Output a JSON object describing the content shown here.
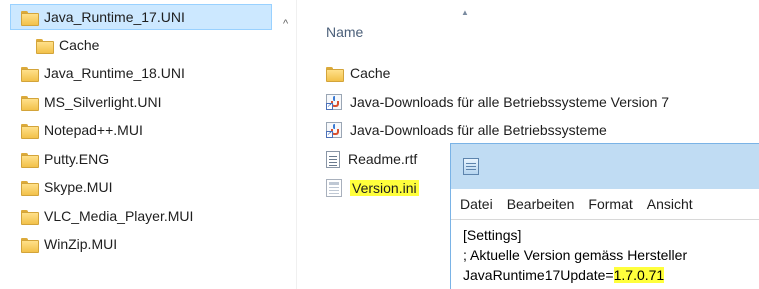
{
  "nav_tree": {
    "items": [
      {
        "label": "Java_Runtime_17.UNI",
        "selected": true
      },
      {
        "label": "Cache",
        "selected": false
      },
      {
        "label": "Java_Runtime_18.UNI",
        "selected": false
      },
      {
        "label": "MS_Silverlight.UNI",
        "selected": false
      },
      {
        "label": "Notepad++.MUI",
        "selected": false
      },
      {
        "label": "Putty.ENG",
        "selected": false
      },
      {
        "label": "Skype.MUI",
        "selected": false
      },
      {
        "label": "VLC_Media_Player.MUI",
        "selected": false
      },
      {
        "label": "WinZip.MUI",
        "selected": false
      }
    ],
    "scroll_up_glyph": "^"
  },
  "content": {
    "column_header": "Name",
    "sort_glyph": "▲",
    "files": [
      {
        "name": "Cache",
        "icon": "folder-icon"
      },
      {
        "name": "Java-Downloads für alle Betriebssysteme Version 7",
        "icon": "java-link-icon"
      },
      {
        "name": "Java-Downloads für alle Betriebssysteme",
        "icon": "java-link-icon"
      },
      {
        "name": "Readme.rtf",
        "icon": "document-icon"
      },
      {
        "name": "Version.ini",
        "icon": "ini-file-icon",
        "highlighted": true
      }
    ]
  },
  "notepad": {
    "menu": [
      "Datei",
      "Bearbeiten",
      "Format",
      "Ansicht"
    ],
    "lines": {
      "line1": "[Settings]",
      "line2": "; Aktuelle Version gemäss Hersteller",
      "line3_key": "JavaRuntime17Update=",
      "line3_value": "1.7.0.71"
    }
  },
  "colors": {
    "selection": "#cce8ff",
    "highlight": "#ffff3c",
    "notepad_titlebar": "#c0dcf3"
  }
}
